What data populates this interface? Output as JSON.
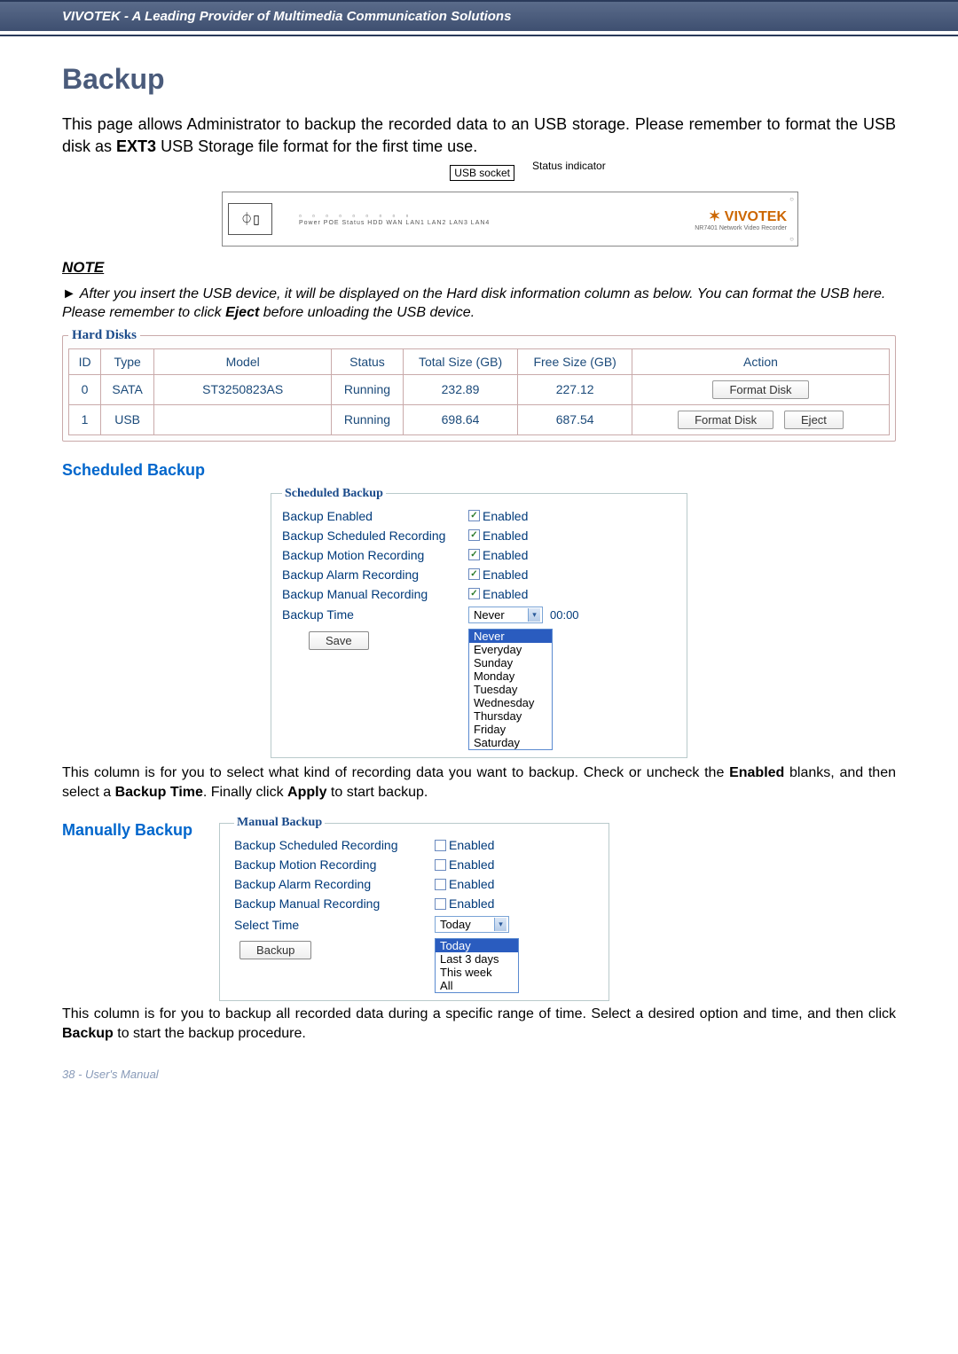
{
  "header": {
    "tagline": "VIVOTEK - A Leading Provider of Multimedia Communication Solutions"
  },
  "page": {
    "title": "Backup",
    "intro_a": "This page allows Administrator to backup the recorded data to an USB storage. Please remember to format the USB disk as ",
    "intro_ext": "EXT3",
    "intro_b": " USB Storage file format for the first time use."
  },
  "diagram": {
    "usb_socket": "USB socket",
    "status_indicator": "Status indicator",
    "led_squares": "▫ ▫ ▫ ▫ ▫ ▫ ▫ ▫ ▫",
    "led_labels": "Power POE Status HDD WAN LAN1 LAN2 LAN3 LAN4",
    "brand": "VIVOTEK",
    "brand_sub": "NR7401 Network Video Recorder"
  },
  "note": {
    "heading": "NOTE",
    "arrow": "►",
    "text_a": " After you insert the USB device, it will be displayed on the Hard disk information column as below. You can format the USB here. Please remember to click ",
    "eject_word": "Eject",
    "text_b": " before unloading the USB device."
  },
  "hard_disks": {
    "legend": "Hard Disks",
    "headers": {
      "id": "ID",
      "type": "Type",
      "model": "Model",
      "status": "Status",
      "total": "Total Size (GB)",
      "free": "Free Size (GB)",
      "action": "Action"
    },
    "rows": [
      {
        "id": "0",
        "type": "SATA",
        "model": "ST3250823AS",
        "status": "Running",
        "total": "232.89",
        "free": "227.12",
        "btns": [
          "Format Disk"
        ]
      },
      {
        "id": "1",
        "type": "USB",
        "model": "",
        "status": "Running",
        "total": "698.64",
        "free": "687.54",
        "btns": [
          "Format Disk",
          "Eject"
        ]
      }
    ]
  },
  "sched": {
    "section_title": "Scheduled Backup",
    "legend": "Scheduled Backup",
    "rows": {
      "backup_enabled": "Backup Enabled",
      "scheduled_rec": "Backup Scheduled Recording",
      "motion_rec": "Backup Motion Recording",
      "alarm_rec": "Backup Alarm Recording",
      "manual_rec": "Backup Manual Recording",
      "backup_time": "Backup Time"
    },
    "enabled_label": "Enabled",
    "time_select": "Never",
    "time_value": "00:00",
    "options": [
      "Never",
      "Everyday",
      "Sunday",
      "Monday",
      "Tuesday",
      "Wednesday",
      "Thursday",
      "Friday",
      "Saturday"
    ],
    "save": "Save",
    "desc_a": "This column is for you to select what kind of recording data you want to backup. Check or uncheck the ",
    "desc_b": " blanks, and then select a ",
    "desc_c": ". Finally click ",
    "desc_d": " to start backup.",
    "bold_enabled": "Enabled",
    "bold_backup_time": "Backup Time",
    "bold_apply": "Apply"
  },
  "manual": {
    "section_title": "Manually Backup",
    "legend": "Manual Backup",
    "rows": {
      "scheduled_rec": "Backup Scheduled Recording",
      "motion_rec": "Backup Motion Recording",
      "alarm_rec": "Backup Alarm Recording",
      "manual_rec": "Backup Manual Recording",
      "select_time": "Select Time"
    },
    "enabled_label": "Enabled",
    "time_select": "Today",
    "options": [
      "Today",
      "Last 3 days",
      "This week",
      "All"
    ],
    "backup_btn": "Backup",
    "desc_a": "This column is for you to backup all recorded data during a specific range of time. Select a desired option and time, and then click ",
    "desc_b": " to start the backup procedure.",
    "bold_backup": "Backup"
  },
  "footer": {
    "text": "38 - User's Manual"
  }
}
